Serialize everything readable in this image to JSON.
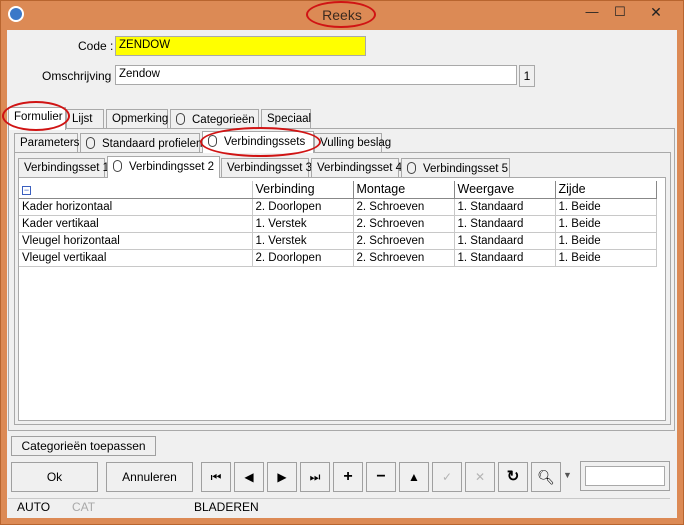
{
  "window": {
    "title": "Reeks",
    "colors": {
      "frame": "#dc8a55",
      "code_highlight": "#ffff00",
      "annotation_ring": "#d01414"
    }
  },
  "form": {
    "code_label": "Code :",
    "code_value": "ZENDOW",
    "omschrijving_label": "Omschrijving :",
    "omschrijving_value": "Zendow",
    "omschrijving_badge": "1"
  },
  "main_tabs": [
    "Formulier",
    "Lijst",
    "Opmerking",
    "Categorieën",
    "Speciaal"
  ],
  "sub_tabs": [
    "Parameters",
    "Standaard profielen",
    "Verbindingssets",
    "Vulling beslag"
  ],
  "set_tabs": [
    "Verbindingsset 1",
    "Verbindingsset 2",
    "Verbindingsset 3",
    "Verbindingsset 4",
    "Verbindingsset 5"
  ],
  "grid": {
    "collapse_icon": "minus-box",
    "columns": [
      "",
      "Verbinding",
      "Montage",
      "Weergave",
      "Zijde"
    ],
    "rows": [
      [
        "Kader horizontaal",
        "2. Doorlopen",
        "2. Schroeven",
        "1. Standaard",
        "1. Beide"
      ],
      [
        "Kader vertikaal",
        "1. Verstek",
        "2. Schroeven",
        "1. Standaard",
        "1. Beide"
      ],
      [
        "Vleugel horizontaal",
        "1. Verstek",
        "2. Schroeven",
        "1. Standaard",
        "1. Beide"
      ],
      [
        "Vleugel vertikaal",
        "2. Doorlopen",
        "2. Schroeven",
        "1. Standaard",
        "1. Beide"
      ]
    ]
  },
  "buttons": {
    "categories_apply": "Categorieën toepassen",
    "ok": "Ok",
    "cancel": "Annuleren"
  },
  "nav": {
    "first": "⏮",
    "prev": "◀",
    "next": "▶",
    "last": "⏭",
    "add": "+",
    "remove": "−",
    "up": "▲",
    "confirm": "✓",
    "discard": "✕",
    "refresh": "↻",
    "find": "🔍︎"
  },
  "status": {
    "auto": "AUTO",
    "cat": "CAT",
    "mode": "BLADEREN"
  }
}
